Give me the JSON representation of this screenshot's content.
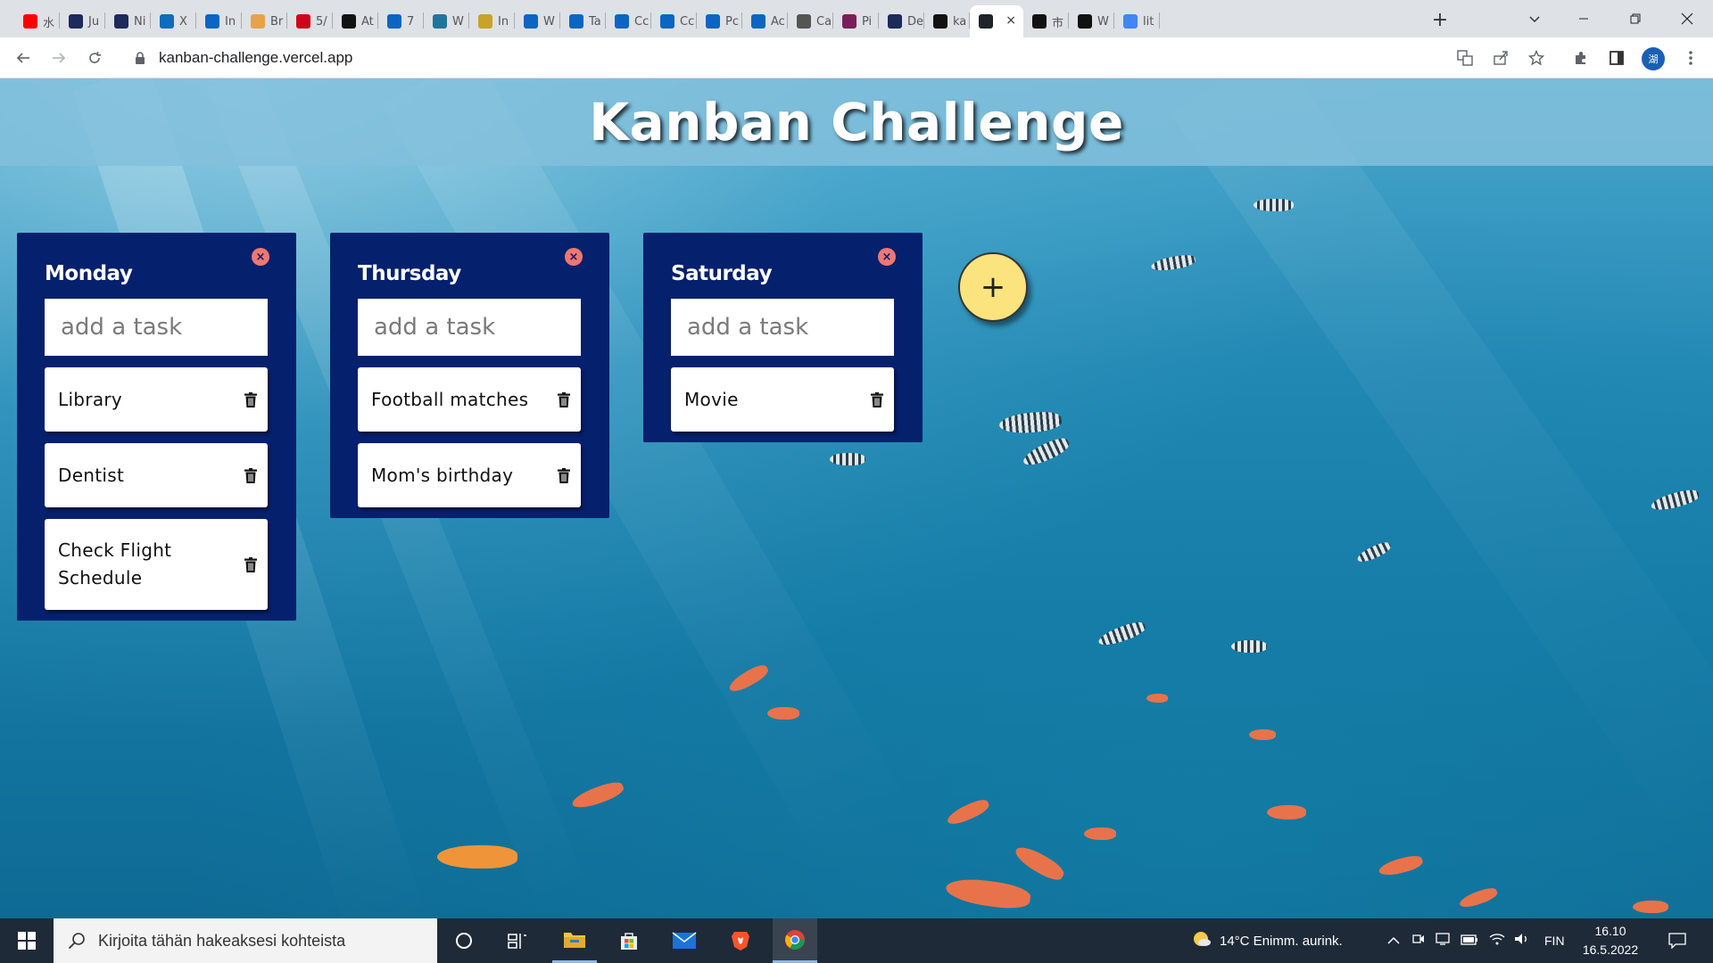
{
  "browser": {
    "tabs": [
      {
        "title": "水",
        "favicon": "youtube-icon",
        "color": "#ff0000"
      },
      {
        "title": "Ju",
        "favicon": "hs-icon",
        "color": "#1c2a5c"
      },
      {
        "title": "Ni",
        "favicon": "hs-icon",
        "color": "#1c2a5c"
      },
      {
        "title": "X",
        "favicon": "outlook-icon",
        "color": "#0f6cbd"
      },
      {
        "title": "In",
        "favicon": "linkedin-icon",
        "color": "#0a66c2"
      },
      {
        "title": "Br",
        "favicon": "generic-icon",
        "color": "#e8a24a"
      },
      {
        "title": "5/",
        "favicon": "vg-icon",
        "color": "#d0021b"
      },
      {
        "title": "At",
        "favicon": "wix-icon",
        "color": "#111111"
      },
      {
        "title": "7",
        "favicon": "linkedin-icon",
        "color": "#0a66c2"
      },
      {
        "title": "W",
        "favicon": "wordpress-icon",
        "color": "#21759b"
      },
      {
        "title": "In",
        "favicon": "generic-icon",
        "color": "#c9a227"
      },
      {
        "title": "W",
        "favicon": "linkedin-icon",
        "color": "#0a66c2"
      },
      {
        "title": "Ta",
        "favicon": "linkedin-icon",
        "color": "#0a66c2"
      },
      {
        "title": "Cc",
        "favicon": "linkedin-icon",
        "color": "#0a66c2"
      },
      {
        "title": "Cc",
        "favicon": "linkedin-icon",
        "color": "#0a66c2"
      },
      {
        "title": "Pc",
        "favicon": "linkedin-icon",
        "color": "#0a66c2"
      },
      {
        "title": "Ac",
        "favicon": "linkedin-icon",
        "color": "#0a66c2"
      },
      {
        "title": "Ca",
        "favicon": "globe-icon",
        "color": "#555555"
      },
      {
        "title": "Pi",
        "favicon": "cgi-icon",
        "color": "#7b1f5a"
      },
      {
        "title": "De",
        "favicon": "generic-icon",
        "color": "#1c2a5c"
      },
      {
        "title": "ka",
        "favicon": "generic-icon",
        "color": "#111111"
      },
      {
        "title": "",
        "favicon": "react-icon",
        "color": "#20232a",
        "active": true
      },
      {
        "title": "市",
        "favicon": "wix-icon",
        "color": "#111111"
      },
      {
        "title": "W",
        "favicon": "wix-icon",
        "color": "#111111"
      },
      {
        "title": "lit",
        "favicon": "google-icon",
        "color": "#4285f4"
      }
    ],
    "url": "kanban-challenge.vercel.app",
    "profile_initial": "湖"
  },
  "app": {
    "title": "Kanban Challenge",
    "input_placeholder": "add a task",
    "columns": [
      {
        "name": "Monday",
        "tasks": [
          "Library",
          "Dentist",
          "Check Flight Schedule"
        ]
      },
      {
        "name": "Thursday",
        "tasks": [
          "Football matches",
          "Mom's birthday"
        ]
      },
      {
        "name": "Saturday",
        "tasks": [
          "Movie"
        ]
      }
    ],
    "add_column_label": "+",
    "colors": {
      "header_bg": "#82c0dc",
      "column_bg": "#05206d",
      "delete_button": "#f07772",
      "add_button": "#fbe37d"
    }
  },
  "taskbar": {
    "search_placeholder": "Kirjoita tähän hakeaksesi kohteista",
    "weather": "14°C  Enimm. aurink.",
    "language": "FIN",
    "time": "16.10",
    "date": "16.5.2022"
  }
}
